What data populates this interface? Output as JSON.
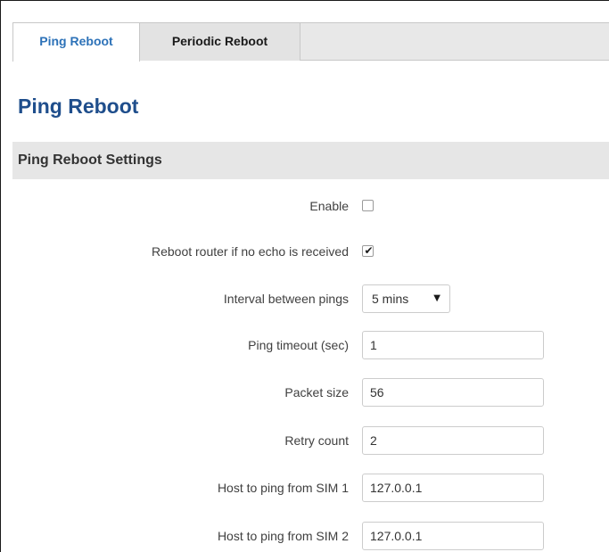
{
  "tabs": [
    {
      "label": "Ping Reboot",
      "active": true
    },
    {
      "label": "Periodic Reboot",
      "active": false
    }
  ],
  "page_title": "Ping Reboot",
  "section": {
    "title": "Ping Reboot Settings"
  },
  "fields": {
    "enable": {
      "label": "Enable",
      "checked": false
    },
    "reboot_no_echo": {
      "label": "Reboot router if no echo is received",
      "checked": true,
      "mark": "✔"
    },
    "interval": {
      "label": "Interval between pings",
      "value": "5 mins",
      "arrow": "▼"
    },
    "ping_timeout": {
      "label": "Ping timeout (sec)",
      "value": "1"
    },
    "packet_size": {
      "label": "Packet size",
      "value": "56"
    },
    "retry_count": {
      "label": "Retry count",
      "value": "2"
    },
    "host_sim1": {
      "label": "Host to ping from SIM 1",
      "value": "127.0.0.1"
    },
    "host_sim2": {
      "label": "Host to ping from SIM 2",
      "value": "127.0.0.1"
    }
  },
  "colors": {
    "active_tab_text": "#2d72b8",
    "page_title": "#1f4e8c",
    "section_bg": "#e6e6e6",
    "tab_bar_bg": "#e8e8e8"
  }
}
